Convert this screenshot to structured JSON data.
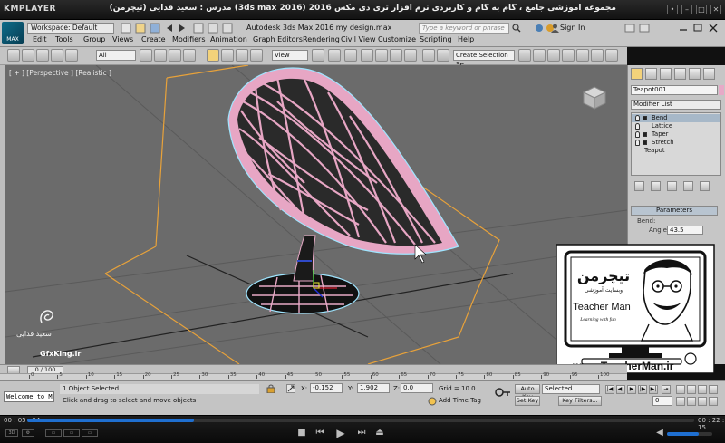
{
  "player": {
    "logo": "KMPLAYER",
    "caption": "مجموعه آموزشی جامع ، گام به گام و کاربردی نرم افزار تری دی مکس 2016 (3ds max 2016) مدرس : سعید فدایی (تیچرمن) گروه آموزشی پادشاه گرافیست ها",
    "window_buttons": [
      "pin-icon",
      "minimize-icon",
      "maximize-icon",
      "close-icon"
    ],
    "time_elapsed": "00 : 05 : 34",
    "time_total": "00 : 22 : 15",
    "progress": 0.25
  },
  "max": {
    "logo_text": "MAX",
    "workspace": "Workspace: Default",
    "title": "Autodesk 3ds Max 2016    my design.max",
    "search_placeholder": "Type a keyword or phrase",
    "sign_in": "Sign In",
    "menu": [
      "Edit",
      "Tools",
      "Group",
      "Views",
      "Create",
      "Modifiers",
      "Animation",
      "Graph Editors",
      "Rendering",
      "Civil View",
      "Customize",
      "Scripting",
      "Help"
    ],
    "toolbar": {
      "filter": "All",
      "ref_coord": "View",
      "selection_set": "Create Selection Se"
    }
  },
  "viewport": {
    "label": "[ + ] [Perspective ] [Realistic ]",
    "background": "#6b6b6b",
    "object_color": "#e8a9c6"
  },
  "panel": {
    "object_name": "Teapot001",
    "modifier_list": "Modifier List",
    "stack": [
      {
        "label": "Bend",
        "selected": true
      },
      {
        "label": "Lattice",
        "selected": false
      },
      {
        "label": "Taper",
        "selected": false
      },
      {
        "label": "Stretch",
        "selected": false
      },
      {
        "label": "Teapot",
        "selected": false
      }
    ],
    "rollout_title": "Parameters",
    "bend_label": "Bend:",
    "angle_label": "Angle:",
    "angle_value": "43.5"
  },
  "watermark": {
    "name": "سعید فدایی",
    "site": "GfxKing.ir"
  },
  "teacher": {
    "logo_text": "تیچرمن",
    "subtitle": "وبسایت آموزشی",
    "name": "Teacher Man",
    "tagline": "Learning with fun",
    "url": "www.TeacherMan.ir"
  },
  "timeline": {
    "slider": "0 / 100",
    "ticks": [
      "0",
      "5",
      "10",
      "15",
      "20",
      "25",
      "30",
      "35",
      "40",
      "45",
      "50",
      "55",
      "60",
      "65",
      "70",
      "75",
      "80",
      "85",
      "90",
      "95",
      "100"
    ]
  },
  "status": {
    "listener": "Welcome to M",
    "selection": "1 Object Selected",
    "prompt": "Click and drag to select and move objects",
    "x_label": "X:",
    "x": "-0.152",
    "y_label": "Y:",
    "y": "1.902",
    "z_label": "Z:",
    "z": "0.0",
    "grid": "Grid = 10.0",
    "add_time_tag": "Add Time Tag",
    "auto_key": "Auto Key",
    "set_key": "Set Key",
    "selected": "Selected",
    "key_filters": "Key Filters...",
    "frame": "0"
  }
}
